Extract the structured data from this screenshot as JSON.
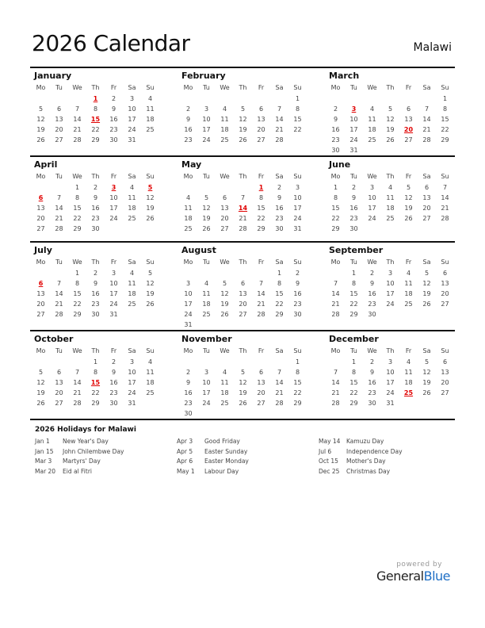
{
  "header": {
    "title": "2026 Calendar",
    "country": "Malawi"
  },
  "weekdays": [
    "Mo",
    "Tu",
    "We",
    "Th",
    "Fr",
    "Sa",
    "Su"
  ],
  "accent_color": "#e00000",
  "months": [
    {
      "name": "January",
      "offset": 3,
      "days": 31,
      "holidays": [
        1,
        15
      ]
    },
    {
      "name": "February",
      "offset": 6,
      "days": 28,
      "holidays": []
    },
    {
      "name": "March",
      "offset": 6,
      "days": 31,
      "holidays": [
        3,
        20
      ]
    },
    {
      "name": "April",
      "offset": 2,
      "days": 30,
      "holidays": [
        3,
        5,
        6
      ]
    },
    {
      "name": "May",
      "offset": 4,
      "days": 31,
      "holidays": [
        1,
        14
      ]
    },
    {
      "name": "June",
      "offset": 0,
      "days": 30,
      "holidays": []
    },
    {
      "name": "July",
      "offset": 2,
      "days": 31,
      "holidays": [
        6
      ]
    },
    {
      "name": "August",
      "offset": 5,
      "days": 31,
      "holidays": []
    },
    {
      "name": "September",
      "offset": 1,
      "days": 30,
      "holidays": []
    },
    {
      "name": "October",
      "offset": 3,
      "days": 31,
      "holidays": [
        15
      ]
    },
    {
      "name": "November",
      "offset": 6,
      "days": 30,
      "holidays": []
    },
    {
      "name": "December",
      "offset": 1,
      "days": 31,
      "holidays": [
        25
      ]
    }
  ],
  "holidays": {
    "title": "2026 Holidays for Malawi",
    "columns": [
      [
        {
          "date": "Jan 1",
          "name": "New Year's Day"
        },
        {
          "date": "Jan 15",
          "name": "John Chilembwe Day"
        },
        {
          "date": "Mar 3",
          "name": "Martyrs' Day"
        },
        {
          "date": "Mar 20",
          "name": "Eid al Fitri"
        }
      ],
      [
        {
          "date": "Apr 3",
          "name": "Good Friday"
        },
        {
          "date": "Apr 5",
          "name": "Easter Sunday"
        },
        {
          "date": "Apr 6",
          "name": "Easter Monday"
        },
        {
          "date": "May 1",
          "name": "Labour Day"
        }
      ],
      [
        {
          "date": "May 14",
          "name": "Kamuzu Day"
        },
        {
          "date": "Jul 6",
          "name": "Independence Day"
        },
        {
          "date": "Oct 15",
          "name": "Mother's Day"
        },
        {
          "date": "Dec 25",
          "name": "Christmas Day"
        }
      ]
    ]
  },
  "branding": {
    "powered_by": "powered by",
    "name_part1": "General",
    "name_part2": "Blue"
  }
}
